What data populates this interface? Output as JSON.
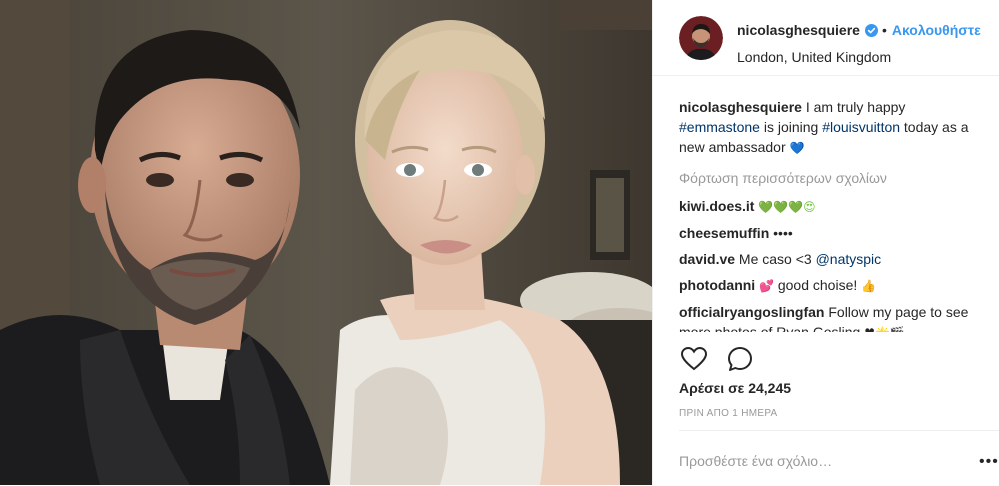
{
  "header": {
    "username": "nicolasghesquiere",
    "verified_icon": "verified-badge-icon",
    "separator": "•",
    "follow_label": "Ακολουθήστε",
    "location": "London, United Kingdom"
  },
  "caption": {
    "username": "nicolasghesquiere",
    "text_1": " I am truly happy ",
    "hashtag_1": "#emmastone",
    "text_2": " is joining ",
    "hashtag_2": "#louisvuitton",
    "text_3": " today as a new ambassador ",
    "emoji": "💙"
  },
  "load_more_label": "Φόρτωση περισσότερων σχολίων",
  "comments": [
    {
      "user": "kiwi.does.it",
      "text": "",
      "emoji": "💚💚💚😍"
    },
    {
      "user": "cheesemuffin",
      "text": "",
      "emoji": "••••"
    },
    {
      "user": "david.ve",
      "text": " Me caso <3 ",
      "mention": "@natyspic"
    },
    {
      "user": "photodanni",
      "text": " good choise! ",
      "emoji_before": " 💕",
      "emoji_after": "👍"
    },
    {
      "user": "officialryangoslingfan",
      "text": " Follow my page to see more photos of Ryan Gosling ",
      "emoji": "♥🌟🎬"
    }
  ],
  "actions": {
    "like_icon": "heart-icon",
    "comment_icon": "comment-bubble-icon"
  },
  "likes": "Αρέσει σε 24,245",
  "time": "ΠΡΙΝ ΑΠΟ 1 ΗΜΕΡΑ",
  "add_comment": {
    "placeholder": "Προσθέστε ένα σχόλιο…",
    "more_label": "•••"
  },
  "colors": {
    "link": "#003569",
    "follow": "#3897f0",
    "muted": "#999999",
    "border": "#efefef"
  }
}
